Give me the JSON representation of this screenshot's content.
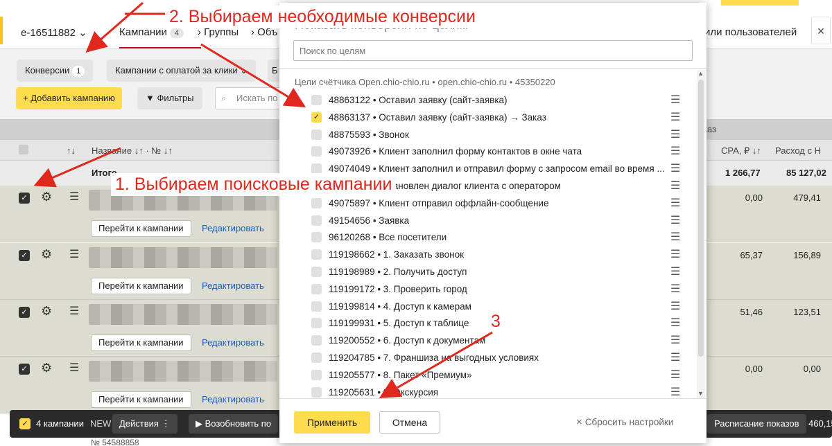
{
  "header": {
    "account": "e-16511882",
    "tabs": [
      {
        "label": "Кампании",
        "badge": "4"
      },
      {
        "label": "Группы"
      },
      {
        "label": "Объ"
      }
    ],
    "users_link": "или пользователей"
  },
  "filters": {
    "conversions_chip": "Конверсии",
    "conversions_count": "1",
    "payment_chip": "Кампании с оплатой за клики",
    "chip_e": "Б",
    "add_campaign": "Добавить кампанию",
    "filters_btn": "Фильтры",
    "search_placeholder": "Искать по"
  },
  "table": {
    "col_name": "Название",
    "col_num": "№",
    "col_cpa": "CPA, ₽",
    "col_spend": "Расход с Н",
    "group_label": "каз",
    "totals_label": "Итого",
    "totals_cpa": "1 266,77",
    "totals_spend": "85 127,02",
    "rows": [
      {
        "goto": "Перейти к кампании",
        "edit": "Редактировать",
        "cpa": "0,00",
        "spend": "479,41"
      },
      {
        "goto": "Перейти к кампании",
        "edit": "Редактировать",
        "cpa": "65,37",
        "spend": "156,89"
      },
      {
        "goto": "Перейти к кампании",
        "edit": "Редактировать",
        "cpa": "51,46",
        "spend": "123,51"
      },
      {
        "goto": "Перейти к кампании",
        "edit": "Редактировать",
        "cpa": "0,00",
        "spend": "0,00"
      }
    ]
  },
  "bottombar": {
    "count_label": "4 кампании",
    "actions": "Действия",
    "resume": "Возобновить по",
    "schedule": "Расписание показов",
    "name_cut": "NEW",
    "num_cut": "№ 54588858",
    "spend_cut": "460,15"
  },
  "modal": {
    "title": "Показать конверсии по целям",
    "search_placeholder": "Поиск по целям",
    "counter_label": "Цели счётчика Open.chio-chio.ru • open.chio-chio.ru • 45350220",
    "goals": [
      {
        "text": "48863122 • Оставил заявку (сайт-заявка)",
        "checked": false
      },
      {
        "text": "48863137 • Оставил заявку (сайт-заявка) → Заказ",
        "checked": true
      },
      {
        "text": "48875593 • Звонок",
        "checked": false
      },
      {
        "text": "49073926 • Клиент заполнил форму контактов в окне чата",
        "checked": false
      },
      {
        "text": "49074049 • Клиент заполнил и отправил форму с запросом email во время ...",
        "checked": false
      },
      {
        "text": "49074109 • Установлен диалог клиента с оператором",
        "checked": false
      },
      {
        "text": "49075897 • Клиент отправил оффлайн-сообщение",
        "checked": false
      },
      {
        "text": "49154656 • Заявка",
        "checked": false
      },
      {
        "text": "96120268 • Все посетители",
        "checked": false
      },
      {
        "text": "119198662 • 1. Заказать звонок",
        "checked": false
      },
      {
        "text": "119198989 • 2. Получить доступ",
        "checked": false
      },
      {
        "text": "119199172 • 3. Проверить город",
        "checked": false
      },
      {
        "text": "119199814 • 4. Доступ к камерам",
        "checked": false
      },
      {
        "text": "119199931 • 5. Доступ к таблице",
        "checked": false
      },
      {
        "text": "119200552 • 6. Доступ к документам",
        "checked": false
      },
      {
        "text": "119204785 • 7. Франшиза на выгодных условиях",
        "checked": false
      },
      {
        "text": "119205577 • 8. Пакет «Премиум»",
        "checked": false
      },
      {
        "text": "119205631 • 9. Экскурсия",
        "checked": false
      }
    ],
    "apply": "Применить",
    "cancel": "Отмена",
    "reset": "Сбросить настройки"
  },
  "annotations": {
    "step1": "1. Выбираем поисковые кампании",
    "step2": "2. Выбираем необходимые конверсии",
    "step3": "3"
  },
  "colors": {
    "accent_yellow": "#ffdb4d",
    "annotation_red": "#e0281e",
    "link_blue": "#1a5fb4"
  }
}
